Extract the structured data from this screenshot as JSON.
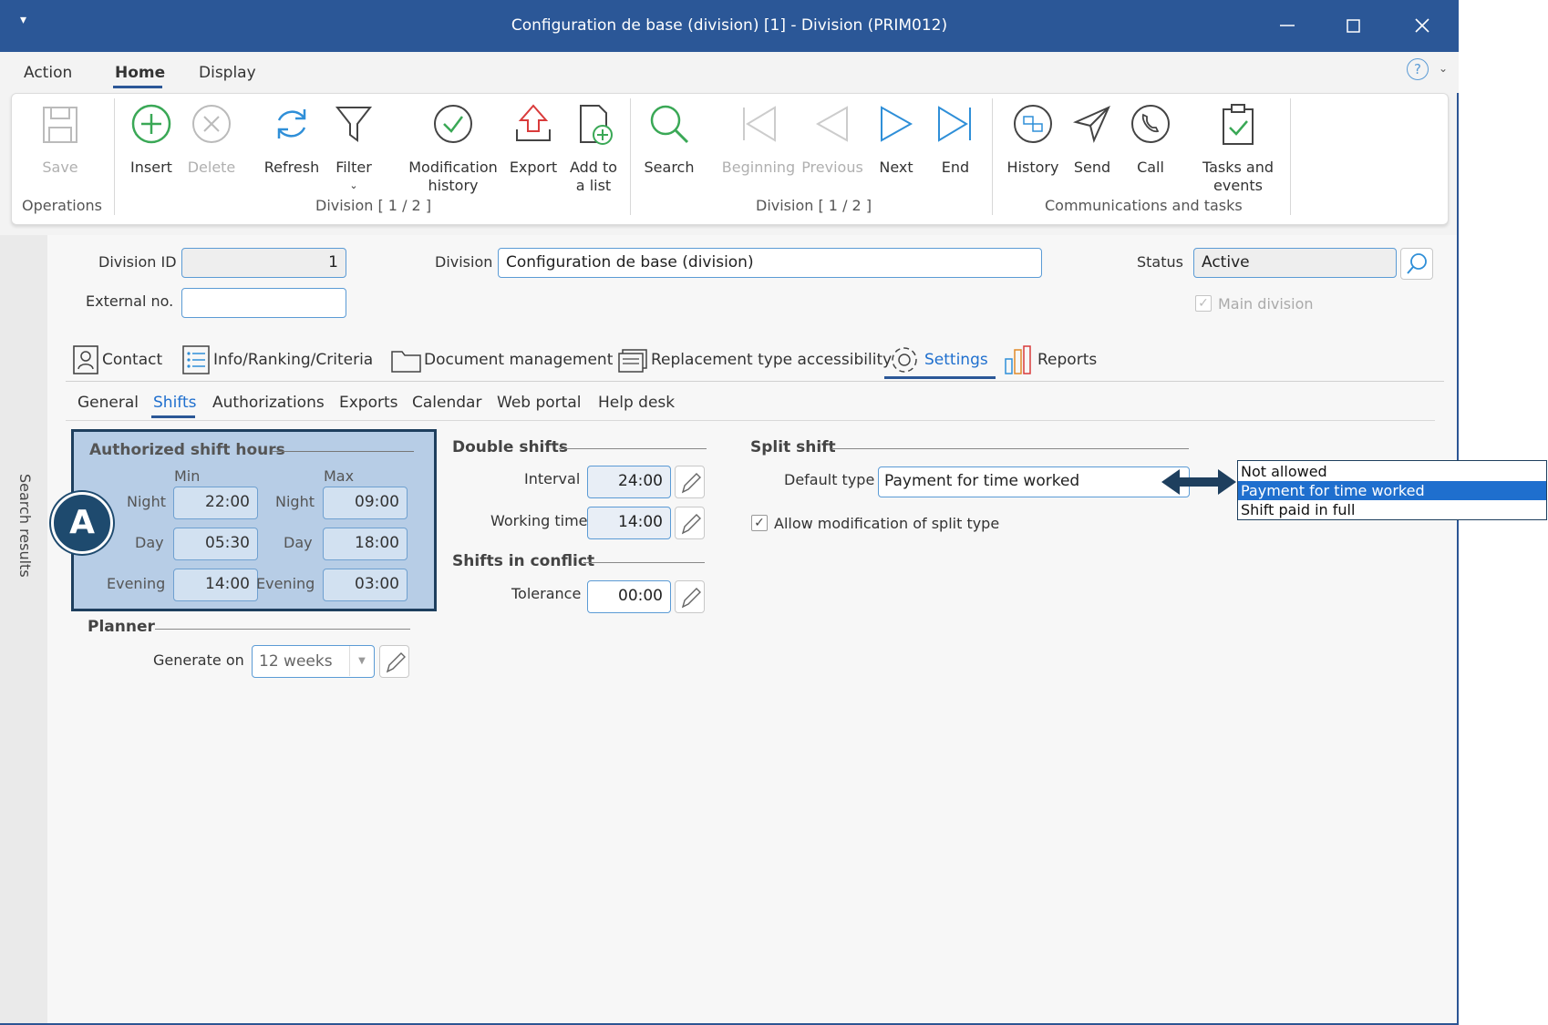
{
  "window": {
    "title": "Configuration de base (division) [1] - Division (PRIM012)"
  },
  "menu": {
    "items": [
      "Action",
      "Home",
      "Display"
    ]
  },
  "ribbon": {
    "operations": {
      "save": "Save",
      "group": "Operations"
    },
    "division_group": {
      "insert": "Insert",
      "delete": "Delete",
      "refresh": "Refresh",
      "filter": "Filter",
      "modification_history_1": "Modification",
      "modification_history_2": "history",
      "export": "Export",
      "add_to_list_1": "Add to",
      "add_to_list_2": "a list",
      "group": "Division [ 1 / 2 ]"
    },
    "nav_group": {
      "search": "Search",
      "beginning": "Beginning",
      "previous": "Previous",
      "next": "Next",
      "end": "End",
      "group": "Division [ 1 / 2 ]"
    },
    "comm_group": {
      "history": "History",
      "send": "Send",
      "call": "Call",
      "tasks_1": "Tasks and",
      "tasks_2": "events",
      "group": "Communications and tasks"
    }
  },
  "sidebar": {
    "label": "Search results"
  },
  "header": {
    "division_id_label": "Division ID",
    "division_id_value": "1",
    "external_no_label": "External no.",
    "external_no_value": "",
    "division_label": "Division",
    "division_value": "Configuration de base (division)",
    "status_label": "Status",
    "status_value": "Active",
    "main_division_label": "Main division"
  },
  "tabs": [
    "Contact",
    "Info/Ranking/Criteria",
    "Document management",
    "Replacement type accessibility",
    "Settings",
    "Reports"
  ],
  "subtabs": [
    "General",
    "Shifts",
    "Authorizations",
    "Exports",
    "Calendar",
    "Web portal",
    "Help desk"
  ],
  "shift_hours": {
    "title": "Authorized shift hours",
    "min_label": "Min",
    "max_label": "Max",
    "night_label": "Night",
    "day_label": "Day",
    "evening_label": "Evening",
    "min_night": "22:00",
    "min_day": "05:30",
    "min_evening": "14:00",
    "max_night": "09:00",
    "max_day": "18:00",
    "max_evening": "03:00"
  },
  "badge": "A",
  "planner": {
    "title": "Planner",
    "generate_label": "Generate on",
    "generate_value": "12 weeks"
  },
  "double_shifts": {
    "title": "Double shifts",
    "interval_label": "Interval",
    "interval_value": "24:00",
    "working_label": "Working time",
    "working_value": "14:00"
  },
  "conflict": {
    "title": "Shifts in conflict",
    "tolerance_label": "Tolerance",
    "tolerance_value": "00:00"
  },
  "split_shift": {
    "title": "Split shift",
    "default_type_label": "Default type",
    "default_type_value": "Payment for time worked",
    "allow_label": "Allow modification of split type",
    "options": [
      "Not allowed",
      "Payment for time worked",
      "Shift paid in full"
    ]
  }
}
